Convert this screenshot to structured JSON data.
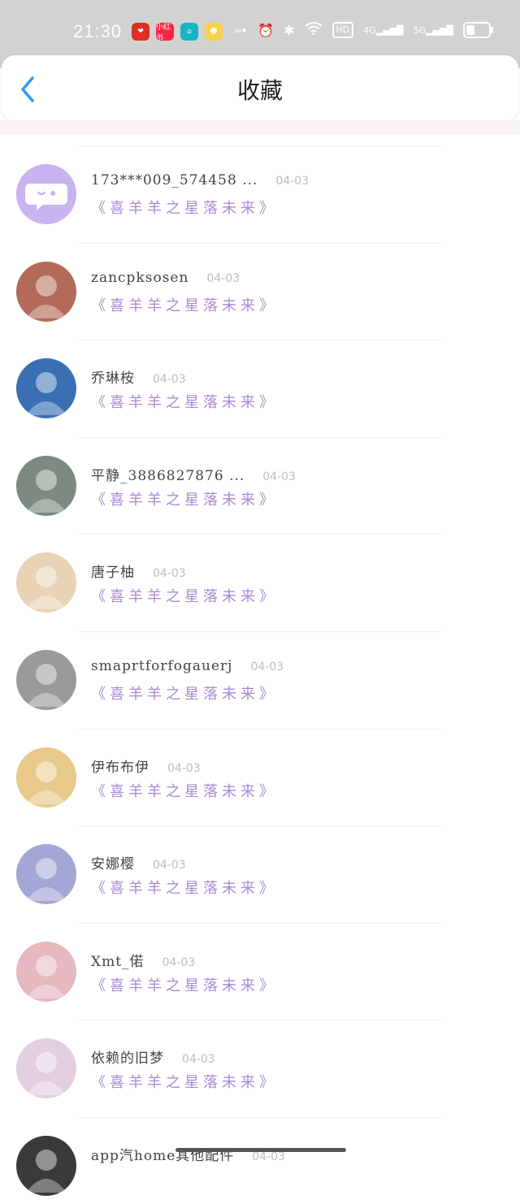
{
  "status_bar": {
    "time": "21:30",
    "app_icons": [
      {
        "name": "pinduoduo-icon",
        "label": "❤",
        "color": "#e02e24"
      },
      {
        "name": "xiaohongshu-icon",
        "label": "小红书",
        "color": "#ff2442"
      },
      {
        "name": "home-app-icon",
        "label": "⌂",
        "color": "#13b5c6"
      },
      {
        "name": "cartoon-app-icon",
        "label": "☻",
        "color": "#f6d24a"
      },
      {
        "name": "wechat-icon",
        "label": "✉",
        "color": "#d2d2d2"
      }
    ],
    "hd_label": "HD",
    "net1": "4G",
    "net2": "5G"
  },
  "header": {
    "title": "收藏"
  },
  "items": [
    {
      "username": "173***009_574458 ...",
      "date": "04-03",
      "title": "《喜羊羊之星落未来》",
      "avatar_bg": "#c9b3f0",
      "avatar_type": "chat"
    },
    {
      "username": "zancpksosen",
      "date": "04-03",
      "title": "《喜羊羊之星落未来》",
      "avatar_bg": "#b46a58",
      "avatar_type": "photo"
    },
    {
      "username": "乔琳桉",
      "date": "04-03",
      "title": "《喜羊羊之星落未来》",
      "avatar_bg": "#3b6fb3",
      "avatar_type": "photo"
    },
    {
      "username": "平静_3886827876 ...",
      "date": "04-03",
      "title": "《喜羊羊之星落未来》",
      "avatar_bg": "#7d8a7f",
      "avatar_type": "photo"
    },
    {
      "username": "唐子柚",
      "date": "04-03",
      "title": "《喜羊羊之星落未来》",
      "avatar_bg": "#e8d3b6",
      "avatar_type": "photo"
    },
    {
      "username": "smaprtforfogauerj",
      "date": "04-03",
      "title": "《喜羊羊之星落未来》",
      "avatar_bg": "#9a9a9a",
      "avatar_type": "photo"
    },
    {
      "username": "伊布布伊",
      "date": "04-03",
      "title": "《喜羊羊之星落未来》",
      "avatar_bg": "#e9c98a",
      "avatar_type": "photo"
    },
    {
      "username": "安娜樱",
      "date": "04-03",
      "title": "《喜羊羊之星落未来》",
      "avatar_bg": "#a4a6d6",
      "avatar_type": "photo"
    },
    {
      "username": "Xmt_偌",
      "date": "04-03",
      "title": "《喜羊羊之星落未来》",
      "avatar_bg": "#e5b9bf",
      "avatar_type": "photo"
    },
    {
      "username": "依赖的旧梦",
      "date": "04-03",
      "title": "《喜羊羊之星落未来》",
      "avatar_bg": "#e3cfe0",
      "avatar_type": "photo"
    },
    {
      "username": "app汽home其他配件",
      "date": "04-03",
      "title": "",
      "avatar_bg": "#3a3a3a",
      "avatar_type": "photo"
    }
  ]
}
